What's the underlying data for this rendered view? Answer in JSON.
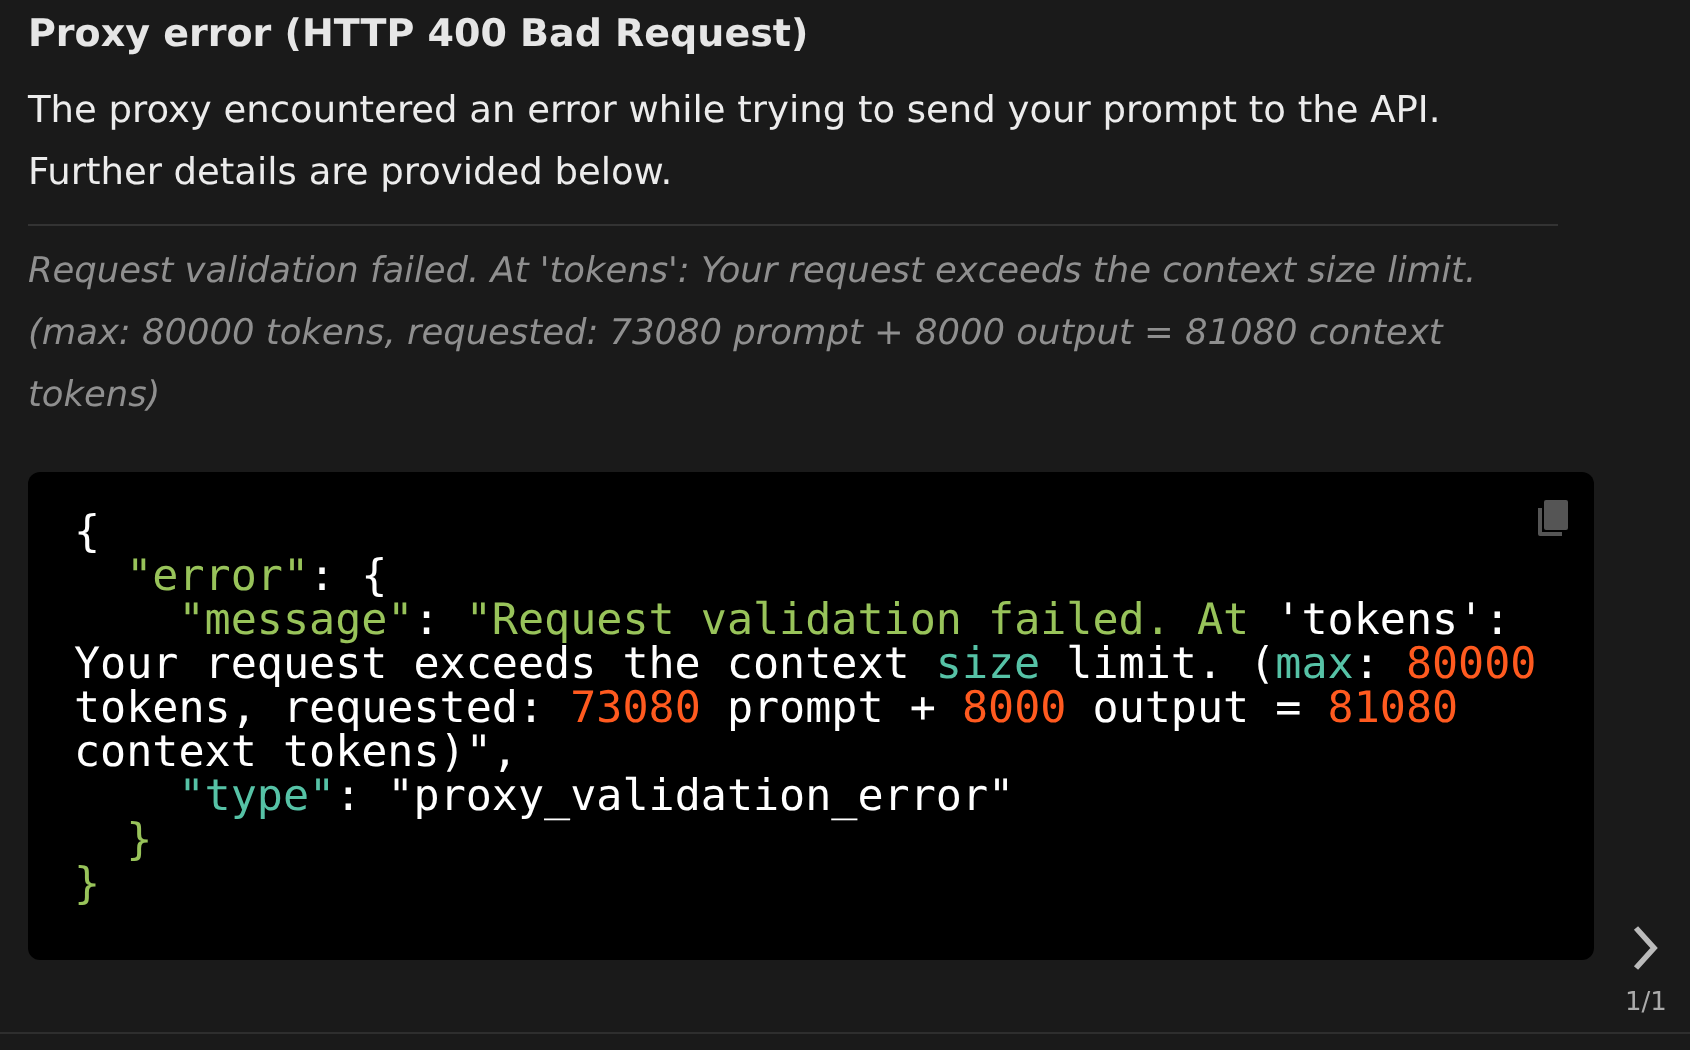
{
  "title": "Proxy error (HTTP 400 Bad Request)",
  "description": "The proxy encountered an error while trying to send your prompt to the API. Further details are provided below.",
  "detail": "Request validation failed. At 'tokens': Your request exceeds the context size limit. (max: 80000 tokens, requested: 73080 prompt + 8000 output = 81080 context tokens)",
  "code_lines": [
    [
      {
        "text": "{",
        "kind": "plain"
      }
    ],
    [
      {
        "text": "  \"error\"",
        "kind": "string"
      },
      {
        "text": ": {",
        "kind": "plain"
      }
    ],
    [
      {
        "text": "    \"message\"",
        "kind": "string"
      },
      {
        "text": ": ",
        "kind": "plain"
      },
      {
        "text": "\"Request validation failed. At ",
        "kind": "string"
      },
      {
        "text": "'tokens':",
        "kind": "plain"
      }
    ],
    [
      {
        "text": "Your request exceeds the context ",
        "kind": "plain"
      },
      {
        "text": "size",
        "kind": "keyword"
      },
      {
        "text": " limit. (",
        "kind": "plain"
      },
      {
        "text": "max",
        "kind": "keyword"
      },
      {
        "text": ": ",
        "kind": "plain"
      },
      {
        "text": "80000",
        "kind": "number"
      }
    ],
    [
      {
        "text": "tokens, requested: ",
        "kind": "plain"
      },
      {
        "text": "73080",
        "kind": "number"
      },
      {
        "text": " prompt + ",
        "kind": "plain"
      },
      {
        "text": "8000",
        "kind": "number"
      },
      {
        "text": " output = ",
        "kind": "plain"
      },
      {
        "text": "81080",
        "kind": "number"
      }
    ],
    [
      {
        "text": "context tokens)\",",
        "kind": "plain"
      }
    ],
    [
      {
        "text": "    \"type\"",
        "kind": "keyword"
      },
      {
        "text": ": ",
        "kind": "plain"
      },
      {
        "text": "\"proxy_validation_error\"",
        "kind": "plain"
      }
    ],
    [
      {
        "text": "  }",
        "kind": "string"
      }
    ],
    [
      {
        "text": "}",
        "kind": "string"
      }
    ]
  ],
  "pager": {
    "position": "1/1"
  }
}
